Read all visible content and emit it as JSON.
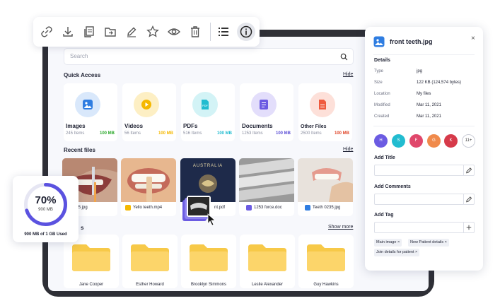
{
  "toolbar": {
    "actions": [
      "link-icon",
      "download-icon",
      "copy-icon",
      "move-icon",
      "edit-icon",
      "star-icon",
      "eye-icon",
      "trash-icon",
      "list-icon",
      "info-icon"
    ]
  },
  "search": {
    "placeholder": "Search"
  },
  "quick_access": {
    "title": "Quick Access",
    "hide_label": "Hide",
    "items": [
      {
        "name": "Images",
        "count": "245 Items",
        "size": "100 MB",
        "color": "#2f7de1",
        "bg": "#d9e8fb",
        "size_color": "#2aa82a"
      },
      {
        "name": "Videos",
        "count": "56 Items",
        "size": "100 MB",
        "color": "#f5b800",
        "bg": "#fdefc4",
        "size_color": "#f5b800"
      },
      {
        "name": "PDFs",
        "count": "516 Items",
        "size": "100 MB",
        "color": "#22bcd0",
        "bg": "#d3f3f6",
        "size_color": "#22bcd0"
      },
      {
        "name": "Documents",
        "count": "1253 Items",
        "size": "100 MB",
        "color": "#6b5be2",
        "bg": "#e3defb",
        "size_color": "#5b4ed6"
      },
      {
        "name": "Other Files",
        "count": "2500 Items",
        "size": "100 MB",
        "color": "#ef5a3d",
        "bg": "#fde0d9",
        "size_color": "#e0472a"
      }
    ]
  },
  "recent_files": {
    "title": "Recent files",
    "hide_label": "Hide",
    "items": [
      {
        "name": "th 0235.jpg"
      },
      {
        "name": "Yello teeth.mp4"
      },
      {
        "name": "nt.pdf"
      },
      {
        "name": "1253 force.doc"
      },
      {
        "name": "Teeth 0235.jpg"
      }
    ],
    "passport_text": "AUSTRALIA"
  },
  "folders": {
    "title": "s",
    "show_more_label": "Show more",
    "items": [
      {
        "name": "Jane Cooper"
      },
      {
        "name": "Esther Howard"
      },
      {
        "name": "Brooklyn Simmons"
      },
      {
        "name": "Leslie Alexander"
      },
      {
        "name": "Guy Hawkins"
      }
    ]
  },
  "storage": {
    "percent_label": "70%",
    "used_amount": "900 MB",
    "summary": "900 MB of 1 GB Used",
    "fraction": 0.7
  },
  "details": {
    "file_name": "front teeth.jpg",
    "close_glyph": "×",
    "section_title": "Details",
    "rows": [
      {
        "key": "Type",
        "value": "jpg"
      },
      {
        "key": "Size",
        "value": "122 KB (124,574 bytes)"
      },
      {
        "key": "Location",
        "value": "My files"
      },
      {
        "key": "Modified",
        "value": "Mar 11, 2021"
      },
      {
        "key": "Created",
        "value": "Mar 11, 2021"
      }
    ],
    "avatars": [
      {
        "initial": "H",
        "color": "#6b5be2"
      },
      {
        "initial": "S",
        "color": "#22bcd0"
      },
      {
        "initial": "F",
        "color": "#e0476b"
      },
      {
        "initial": "G",
        "color": "#f08a4b"
      },
      {
        "initial": "K",
        "color": "#d63a4a"
      }
    ],
    "avatars_more": "11+",
    "add_title_label": "Add Title",
    "add_comments_label": "Add Comments",
    "add_tag_label": "Add Tag",
    "tags": [
      "Main image",
      "New Patient details",
      "Join details for patient"
    ],
    "tag_remove_glyph": "×"
  }
}
